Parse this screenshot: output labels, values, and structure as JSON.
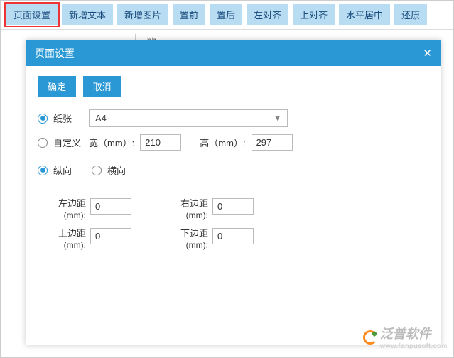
{
  "toolbar": {
    "page_setup": "页面设置",
    "add_text": "新增文本",
    "add_image": "新增图片",
    "bring_front": "置前",
    "send_back": "置后",
    "align_left": "左对齐",
    "align_top": "上对齐",
    "center_h": "水平居中",
    "restore": "还原"
  },
  "behind": {
    "tag": "bh"
  },
  "dialog": {
    "title": "页面设置",
    "ok": "确定",
    "cancel": "取消",
    "paper_label": "纸张",
    "paper_value": "A4",
    "custom_label": "自定义",
    "width_label": "宽（mm）:",
    "width_value": "210",
    "height_label": "高（mm）:",
    "height_value": "297",
    "portrait": "纵向",
    "landscape": "横向",
    "margin_left_label": "左边距",
    "margin_top_label": "上边距",
    "margin_right_label": "右边距",
    "margin_bottom_label": "下边距",
    "mm_suffix": "(mm):",
    "margin_left": "0",
    "margin_top": "0",
    "margin_right": "0",
    "margin_bottom": "0"
  },
  "watermark": {
    "brand": "泛普软件",
    "url": "www.fanpusoft.com"
  }
}
